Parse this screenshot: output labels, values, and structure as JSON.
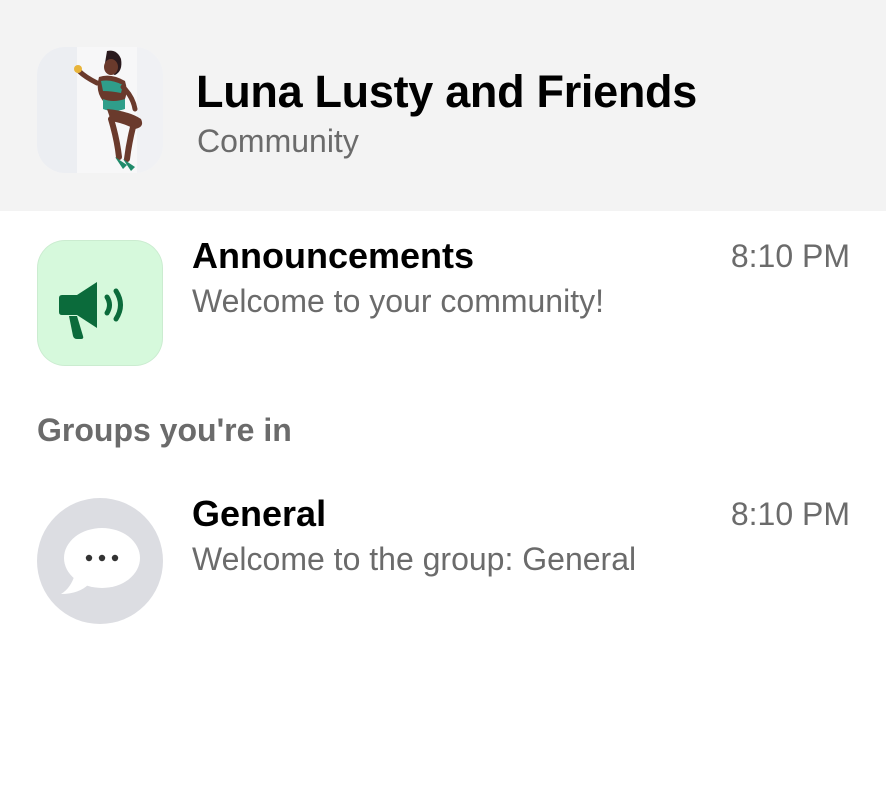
{
  "community": {
    "name": "Luna Lusty and Friends",
    "type_label": "Community",
    "avatar": "community-photo"
  },
  "announcements": {
    "name": "Announcements",
    "time": "8:10 PM",
    "preview": "Welcome to your community!",
    "icon": "megaphone-icon",
    "icon_bg": "#d6f9dc",
    "icon_color": "#0b6b3b"
  },
  "groups_section": {
    "heading": "Groups you're in"
  },
  "groups": [
    {
      "name": "General",
      "time": "8:10 PM",
      "preview": "Welcome to the group: General",
      "icon": "speech-bubble-icon",
      "icon_bg": "#dcdde2"
    }
  ],
  "colors": {
    "header_bg": "#f3f3f3",
    "secondary_text": "#6b6b6b",
    "primary_text": "#000000"
  }
}
